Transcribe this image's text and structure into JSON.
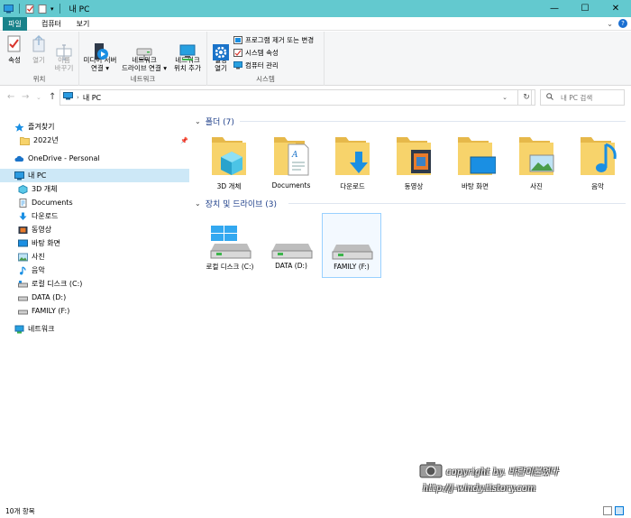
{
  "window": {
    "title": "내 PC",
    "controls": {
      "minimize": "—",
      "maximize": "☐",
      "close": "✕"
    }
  },
  "ribbon_tabs": [
    {
      "label": "파일",
      "active": true
    },
    {
      "label": "컴퓨터",
      "active": false
    },
    {
      "label": "보기",
      "active": false
    }
  ],
  "ribbon": {
    "groups": [
      {
        "label": "위치",
        "buttons": [
          {
            "label": "속성",
            "enabled": true
          },
          {
            "label": "열기",
            "enabled": false
          },
          {
            "label": "이름\n바꾸기",
            "enabled": false
          }
        ]
      },
      {
        "label": "네트워크",
        "buttons": [
          {
            "label": "미디어 서버\n연결 ▾"
          },
          {
            "label": "네트워크\n드라이브 연결 ▾"
          },
          {
            "label": "네트워크\n위치 추가"
          }
        ]
      },
      {
        "label": "시스템",
        "buttons": [
          {
            "label": "설정\n열기"
          }
        ],
        "small_buttons": [
          {
            "label": "프로그램 제거 또는 변경"
          },
          {
            "label": "시스템 속성"
          },
          {
            "label": "컴퓨터 관리"
          }
        ]
      }
    ]
  },
  "address": {
    "path": "내 PC",
    "search_placeholder": "내 PC 검색"
  },
  "nav": {
    "items": [
      {
        "label": "즐겨찾기",
        "icon": "star-icon",
        "level": 0
      },
      {
        "label": "2022년",
        "icon": "folder-icon",
        "level": 1,
        "pinned": true
      },
      {
        "label": "OneDrive - Personal",
        "icon": "cloud-icon",
        "level": 0
      },
      {
        "label": "내 PC",
        "icon": "pc-icon",
        "level": 0,
        "selected": true
      },
      {
        "label": "3D 개체",
        "icon": "3d-objects-icon",
        "level": 1
      },
      {
        "label": "Documents",
        "icon": "documents-icon",
        "level": 1
      },
      {
        "label": "다운로드",
        "icon": "download-icon",
        "level": 1
      },
      {
        "label": "동영상",
        "icon": "video-icon",
        "level": 1
      },
      {
        "label": "바탕 화면",
        "icon": "desktop-icon",
        "level": 1
      },
      {
        "label": "사진",
        "icon": "pictures-icon",
        "level": 1
      },
      {
        "label": "음악",
        "icon": "music-icon",
        "level": 1
      },
      {
        "label": "로컬 디스크 (C:)",
        "icon": "drive-icon",
        "level": 1
      },
      {
        "label": "DATA (D:)",
        "icon": "drive-icon",
        "level": 1
      },
      {
        "label": "FAMILY (F:)",
        "icon": "drive-icon",
        "level": 1
      },
      {
        "label": "네트워크",
        "icon": "network-icon",
        "level": 0
      }
    ]
  },
  "content": {
    "folders_header": "폴더 (7)",
    "folders": [
      {
        "label": "3D 개체",
        "icon": "3d-objects-icon"
      },
      {
        "label": "Documents",
        "icon": "documents-icon"
      },
      {
        "label": "다운로드",
        "icon": "download-icon"
      },
      {
        "label": "동영상",
        "icon": "video-icon"
      },
      {
        "label": "바탕 화면",
        "icon": "desktop-icon"
      },
      {
        "label": "사진",
        "icon": "pictures-icon"
      },
      {
        "label": "음악",
        "icon": "music-icon"
      }
    ],
    "drives_header": "장치 및 드라이브 (3)",
    "drives": [
      {
        "label": "로컬 디스크 (C:)",
        "icon": "windows-drive-icon"
      },
      {
        "label": "DATA (D:)",
        "icon": "drive-icon"
      },
      {
        "label": "FAMILY (F:)",
        "icon": "drive-icon",
        "selected": true
      }
    ]
  },
  "watermark": {
    "line1": "copyright by. 바람이불었다",
    "line2": "http://j-windy.tistory.com"
  },
  "status": {
    "item_count": "10개 항목"
  },
  "colors": {
    "titlebar": "#63c9cf",
    "file_tab": "#19828a",
    "selection": "#cde8f7",
    "folder": "#f7d36b",
    "accent_blue": "#1a8fe3"
  }
}
